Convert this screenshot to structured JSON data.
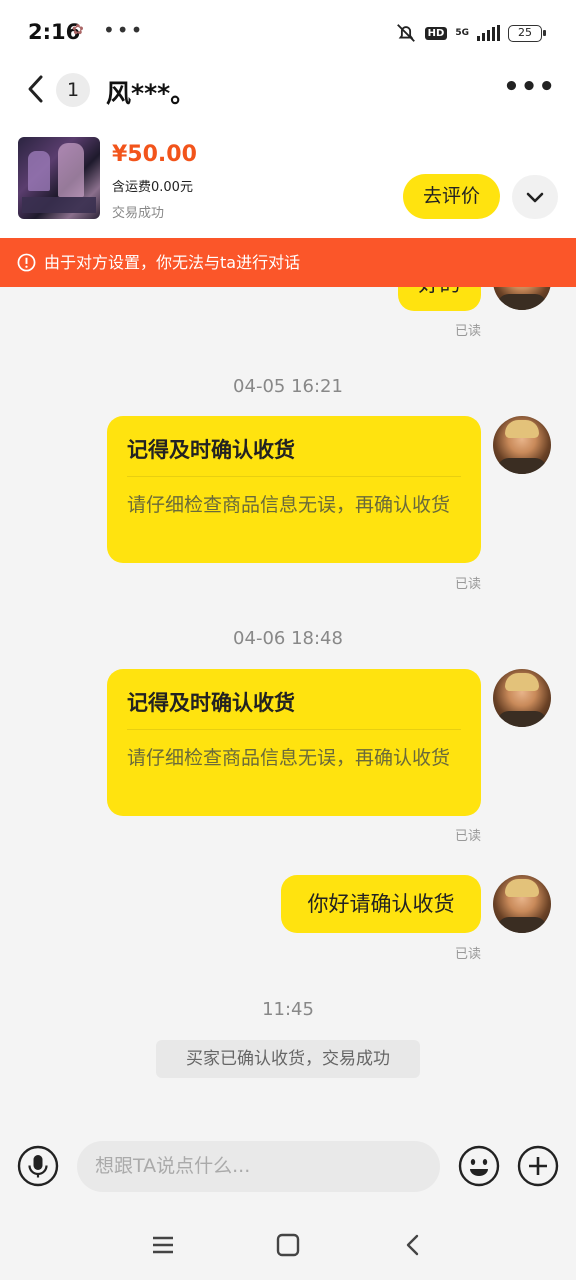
{
  "status_bar": {
    "time": "2:16",
    "dots": "•••",
    "hd": "HD",
    "network": "5G",
    "battery": "25"
  },
  "header": {
    "unread_count": "1",
    "title": "风***。",
    "more": "•••"
  },
  "product": {
    "price": "¥50.00",
    "shipping": "含运费0.00元",
    "status": "交易成功",
    "review_button": "去评价"
  },
  "banner": {
    "text": "由于对方设置，你无法与ta进行对话"
  },
  "messages": {
    "m0": {
      "text": "好的",
      "read": "已读"
    },
    "m1": {
      "time": "04-05 16:21",
      "title": "记得及时确认收货",
      "desc": "请仔细检查商品信息无误，再确认收货",
      "read": "已读"
    },
    "m2": {
      "time": "04-06 18:48",
      "title": "记得及时确认收货",
      "desc": "请仔细检查商品信息无误，再确认收货",
      "read": "已读"
    },
    "m3": {
      "text": "你好请确认收货",
      "read": "已读"
    },
    "m4": {
      "time": "11:45",
      "system": "买家已确认收货，交易成功"
    }
  },
  "input": {
    "placeholder": "想跟TA说点什么..."
  },
  "colors": {
    "accent_yellow": "#ffe30f",
    "banner_orange": "#fb5629",
    "price_red": "#f2541b"
  },
  "icons": [
    "back-arrow-icon",
    "more-icon",
    "chevron-down-icon",
    "warning-icon",
    "microphone-icon",
    "emoji-icon",
    "plus-icon",
    "menu-icon",
    "home-icon",
    "back-nav-icon"
  ]
}
